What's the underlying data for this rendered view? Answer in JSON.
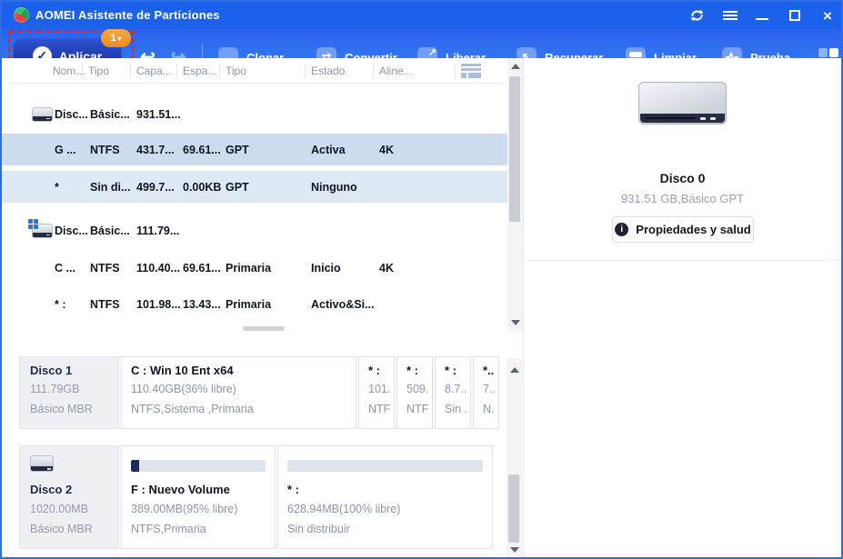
{
  "titlebar": {
    "title": "AOMEI Asistente de Particiones"
  },
  "icons": {
    "check": "✓",
    "badge_chevron": "▾",
    "undo": "↩",
    "redo": "↪",
    "close": "×",
    "clone": "→",
    "convert": "⇄",
    "recover": "↖",
    "expand_ne": "↗",
    "expand_sw": "↙",
    "info": "i"
  },
  "toolbar": {
    "apply_label": "Aplicar",
    "apply_badge": "1",
    "buttons": [
      {
        "label": "Clonar"
      },
      {
        "label": "Convertir"
      },
      {
        "label": "Liberar"
      },
      {
        "label": "Recuperar"
      },
      {
        "label": "Limpiar"
      },
      {
        "label": "Prueba"
      }
    ]
  },
  "table": {
    "columns": [
      "Nom...",
      "Tipo",
      "Capa...",
      "Espa...",
      "Tipo",
      "Estado",
      "Aline..."
    ],
    "rows": [
      {
        "cells": [
          "Disc...",
          "Básic...",
          "931.51...",
          "",
          "",
          "",
          ""
        ]
      },
      {
        "cells": [
          "G ...",
          "NTFS",
          "431.7...",
          "69.61...",
          "GPT",
          "Activa",
          "4K"
        ]
      },
      {
        "cells": [
          "*",
          "Sin di...",
          "499.7...",
          "0.00KB",
          "GPT",
          "Ninguno",
          ""
        ]
      },
      {
        "cells": [
          "Disc...",
          "Básic...",
          "111.79...",
          "",
          "",
          "",
          ""
        ]
      },
      {
        "cells": [
          "C ...",
          "NTFS",
          "110.40...",
          "69.61...",
          "Primaria",
          "Inicio",
          "4K"
        ]
      },
      {
        "cells": [
          "* :",
          "NTFS",
          "101.98...",
          "13.43...",
          "Primaria",
          "Activo&Si...",
          ""
        ]
      }
    ]
  },
  "detail": {
    "disk_name": "Disco 0",
    "disk_meta": "931.51 GB,Básico GPT",
    "properties_label": "Propiedades y salud"
  },
  "overview": {
    "disks": [
      {
        "name": "Disco 1",
        "size": "111.79GB",
        "scheme": "Básico MBR",
        "main_partition": {
          "title": "C : Win 10 Ent x64",
          "size": "110.40GB(36% libre)",
          "meta": "NTFS,Sistema ,Primaria"
        },
        "small_partitions": [
          {
            "title": "* :",
            "size": "101....",
            "meta": "NTF..."
          },
          {
            "title": "* :",
            "size": "509....",
            "meta": "NTF..."
          },
          {
            "title": "* :",
            "size": "8.7...",
            "meta": "Sin ..."
          },
          {
            "title": "*...",
            "size": "7..",
            "meta": "N..."
          }
        ]
      },
      {
        "name": "Disco 2",
        "size": "1020.00MB",
        "scheme": "Básico MBR",
        "partitions": [
          {
            "title": "F : Nuevo Volume",
            "size": "389.00MB(95% libre)",
            "meta": "NTFS,Primaria"
          },
          {
            "title": "* :",
            "size": "628.94MB(100% libre)",
            "meta": "Sin distribuir"
          }
        ]
      }
    ]
  },
  "colors": {
    "titlebar": "#1c61ec",
    "toolbar_top": "#2a63ee",
    "toolbar_bottom": "#3b84f5",
    "apply_button": "#152a92",
    "badge": "#ef8a23",
    "dashed_highlight": "#ea1c24",
    "selected_row": "#cddcee",
    "alt_row": "#dee9f6",
    "used_bar": "#1d2b56"
  }
}
